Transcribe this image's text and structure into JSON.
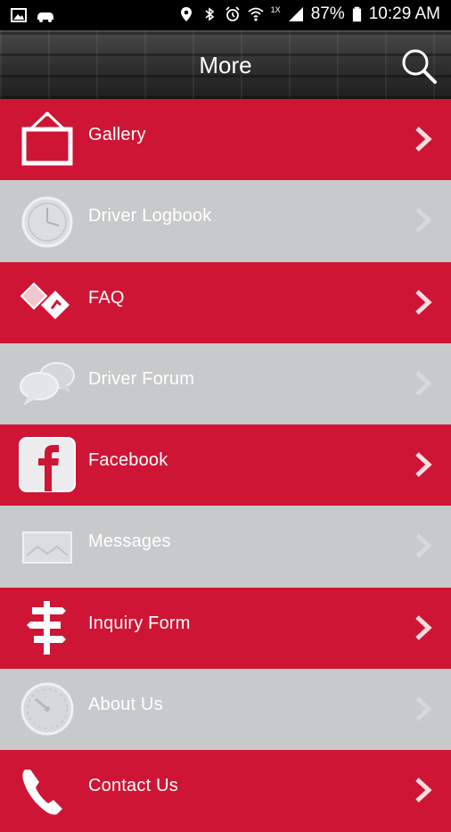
{
  "status_bar": {
    "battery": "87%",
    "time": "10:29 AM",
    "signal_badge": "1X"
  },
  "header": {
    "title": "More"
  },
  "menu": [
    {
      "label": "Gallery",
      "icon": "picture-frame-icon",
      "style": "red"
    },
    {
      "label": "Driver Logbook",
      "icon": "clock-icon",
      "style": "gray"
    },
    {
      "label": "FAQ",
      "icon": "faq-diamond-icon",
      "style": "red"
    },
    {
      "label": "Driver Forum",
      "icon": "chat-bubbles-icon",
      "style": "gray"
    },
    {
      "label": "Facebook",
      "icon": "facebook-icon",
      "style": "red"
    },
    {
      "label": "Messages",
      "icon": "envelope-icon",
      "style": "gray"
    },
    {
      "label": "Inquiry Form",
      "icon": "signpost-icon",
      "style": "red"
    },
    {
      "label": "About Us",
      "icon": "gauge-icon",
      "style": "gray"
    },
    {
      "label": "Contact Us",
      "icon": "phone-icon",
      "style": "red"
    }
  ],
  "colors": {
    "red": "#cf1535",
    "gray": "#c8c9ca"
  }
}
